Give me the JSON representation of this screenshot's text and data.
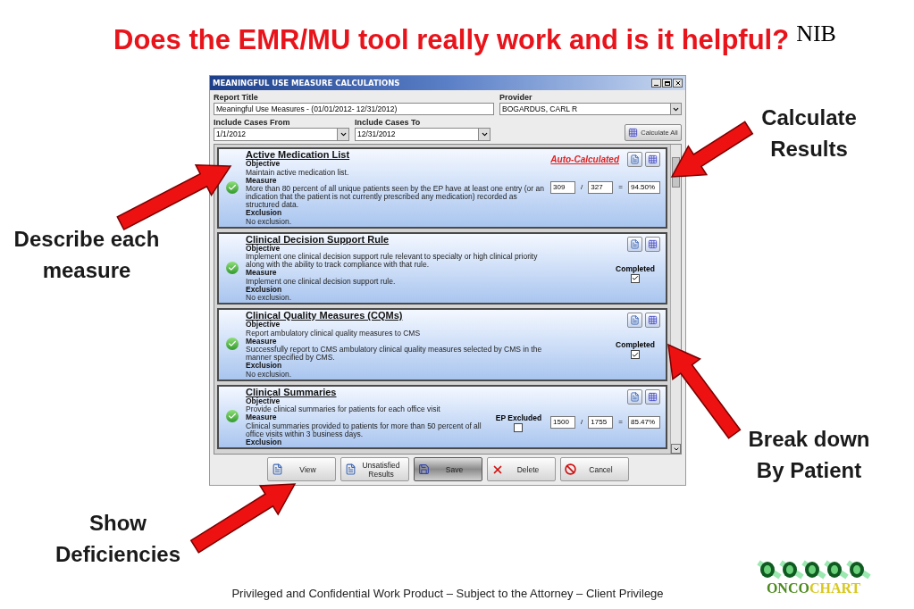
{
  "slide": {
    "title": "Does the EMR/MU tool really work and is it helpful?",
    "corner_mark": "NIB",
    "footer": "Privileged and Confidential Work Product – Subject to the Attorney – Client Privilege",
    "logo": {
      "part_1": "ONCO",
      "part_2": "CHART"
    }
  },
  "callouts": [
    {
      "lines": [
        "Calculate",
        "Results"
      ]
    },
    {
      "lines": [
        "Describe each",
        "measure"
      ]
    },
    {
      "lines": [
        "Break down",
        "By Patient"
      ]
    },
    {
      "lines": [
        "Show",
        "Deficiencies"
      ]
    }
  ],
  "window": {
    "title": "MEANINGFUL USE MEASURE CALCULATIONS",
    "report_title": {
      "label": "Report Title",
      "value": "Meaningful Use Measures - (01/01/2012- 12/31/2012)"
    },
    "provider": {
      "label": "Provider",
      "value": "BOGARDUS, CARL R"
    },
    "cases_from": {
      "label": "Include Cases From",
      "value": "1/1/2012"
    },
    "cases_to": {
      "label": "Include Cases To",
      "value": "12/31/2012"
    },
    "calculate_all": "Calculate All",
    "measures": [
      {
        "kind": "auto",
        "title": "Active Medication List",
        "objective_label": "Objective",
        "objective": "Maintain active medication list.",
        "measure_label": "Measure",
        "measure": "More than 80 percent of all unique patients seen by the EP have at least one entry (or an indication that the patient is not currently prescribed any medication) recorded as structured data.",
        "exclusion_label": "Exclusion",
        "exclusion": "No exclusion.",
        "status": "Auto-Calculated",
        "numerator": "309",
        "denominator": "327",
        "percent": "94.50%"
      },
      {
        "kind": "completion",
        "title": "Clinical Decision Support Rule",
        "objective_label": "Objective",
        "objective": "Implement one clinical decision support rule relevant to specialty or high clinical priority along with the ability to track compliance with that rule.",
        "measure_label": "Measure",
        "measure": "Implement one clinical decision support rule.",
        "exclusion_label": "Exclusion",
        "exclusion": "No exclusion.",
        "check_label": "Completed",
        "checked": true
      },
      {
        "kind": "completion",
        "title": "Clinical Quality Measures (CQMs)",
        "objective_label": "Objective",
        "objective": "Report ambulatory clinical quality measures to CMS",
        "measure_label": "Measure",
        "measure": "Successfully report to CMS ambulatory clinical quality measures selected by CMS in the manner specified by CMS.",
        "exclusion_label": "Exclusion",
        "exclusion": "No exclusion.",
        "check_label": "Completed",
        "checked": true
      },
      {
        "kind": "exclusion_ratio",
        "title": "Clinical Summaries",
        "objective_label": "Objective",
        "objective": "Provide clinical summaries for patients for each office visit",
        "measure_label": "Measure",
        "measure": "Clinical summaries provided to patients for more than 50 percent of all office visits within 3 business days.",
        "exclusion_label": "Exclusion",
        "check_label": "EP Excluded",
        "checked": false,
        "numerator": "1500",
        "denominator": "1755",
        "percent": "85.47%"
      }
    ],
    "ratio_divider": "/",
    "ratio_equals": "=",
    "buttons": [
      {
        "kind": "view",
        "label": "View",
        "focused": false
      },
      {
        "kind": "report",
        "label": "Unsatisfied Results",
        "focused": false
      },
      {
        "kind": "save",
        "label": "Save",
        "focused": true
      },
      {
        "kind": "delete",
        "label": "Delete",
        "focused": false
      },
      {
        "kind": "cancel",
        "label": "Cancel",
        "focused": false
      }
    ]
  }
}
